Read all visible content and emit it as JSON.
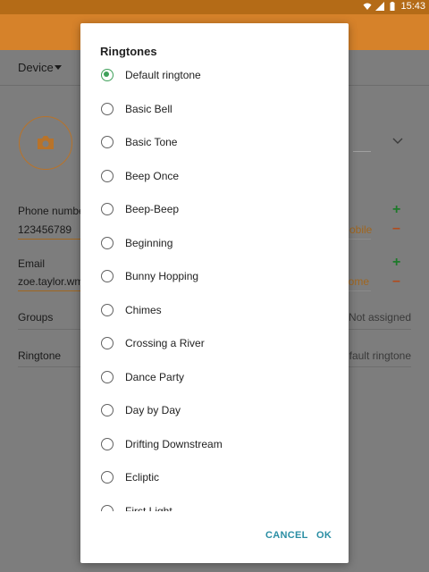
{
  "status_bar": {
    "time": "15:43"
  },
  "form": {
    "device_label": "Device",
    "phone_label": "Phone number",
    "phone_value": "123456789",
    "phone_type": "Mobile",
    "email_label": "Email",
    "email_value": "zoe.taylor.wm",
    "email_type": "Home",
    "groups_label": "Groups",
    "groups_value": "Not assigned",
    "ringtone_label": "Ringtone",
    "ringtone_value": "Default ringtone"
  },
  "dialog": {
    "title": "Ringtones",
    "selected_index": 0,
    "options": [
      "Default ringtone",
      "Basic Bell",
      "Basic Tone",
      "Beep Once",
      "Beep-Beep",
      "Beginning",
      "Bunny Hopping",
      "Chimes",
      "Crossing a River",
      "Dance Party",
      "Day by Day",
      "Drifting Downstream",
      "Ecliptic",
      "First Light"
    ],
    "cancel_label": "CANCEL",
    "ok_label": "OK"
  },
  "colors": {
    "accent": "#d6822a",
    "radio_selected": "#3fa05a",
    "button_text": "#2a8ea4"
  }
}
